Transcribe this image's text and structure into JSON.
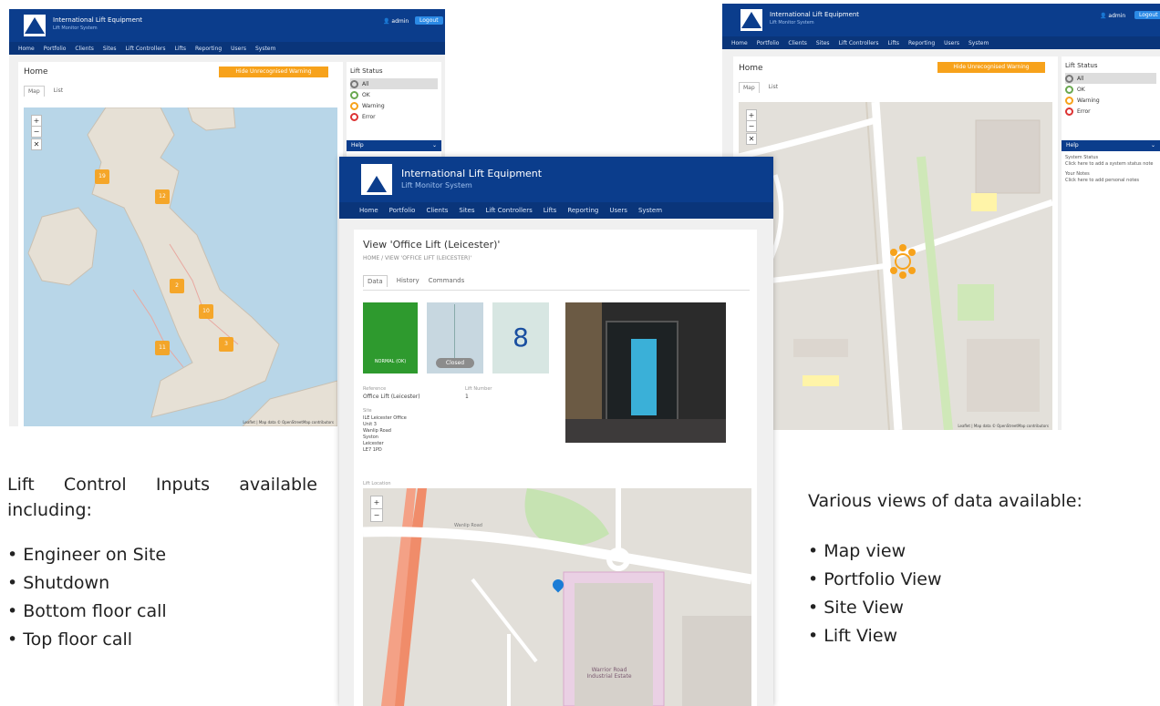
{
  "app": {
    "brand": "International Lift Equipment",
    "subtitle": "Lift Monitor System",
    "user": "admin",
    "logout": "Logout",
    "nav": [
      "Home",
      "Portfolio",
      "Clients",
      "Sites",
      "Lift Controllers",
      "Lifts",
      "Reporting",
      "Users",
      "System"
    ]
  },
  "left_shot": {
    "title": "Home",
    "warning_btn": "Hide Unrecognised Warning",
    "tabs": [
      "Map",
      "List"
    ],
    "zoom_in": "+",
    "zoom_out": "−",
    "reset": "✕",
    "status_title": "Lift Status",
    "status_items": [
      "All",
      "OK",
      "Warning",
      "Error"
    ],
    "help_label": "Help",
    "clusters": [
      "19",
      "12",
      "2",
      "10",
      "11",
      "3"
    ],
    "attribution": "Leaflet | Map data © OpenStreetMap contributors"
  },
  "right_shot": {
    "title": "Home",
    "warning_btn": "Hide Unrecognised Warning",
    "tabs": [
      "Map",
      "List"
    ],
    "zoom_in": "+",
    "zoom_out": "−",
    "reset": "✕",
    "status_title": "Lift Status",
    "status_items": [
      "All",
      "OK",
      "Warning",
      "Error"
    ],
    "help_label": "Help",
    "help_lines": [
      "System Status",
      "Click here to add a system status note",
      "Your Notes",
      "Click here to add personal notes"
    ],
    "attribution": "Leaflet | Map data © OpenStreetMap contributors"
  },
  "center_shot": {
    "view_title": "View 'Office Lift (Leicester)'",
    "breadcrumb": "HOME / VIEW 'OFFICE LIFT (LEICESTER)'",
    "tabs": [
      "Data",
      "History",
      "Commands"
    ],
    "status_tile": "NORMAL (OK)",
    "door_state": "Closed",
    "floor": "8",
    "reference_label": "Reference",
    "reference_value": "Office Lift (Leicester)",
    "lift_number_label": "Lift Number",
    "lift_number_value": "1",
    "site_label": "Site",
    "site_lines": [
      "ILE Leicester Office",
      "Unit 3",
      "Wanlip Road",
      "Syston",
      "Leicester",
      "LE7 1PD"
    ],
    "lift_location_label": "Lift Location",
    "zoom_in": "+",
    "zoom_out": "−",
    "map_labels": [
      "Wanlip Road",
      "Warrior Road Industrial Estate"
    ]
  },
  "captions": {
    "left_heading": "Lift Control Inputs available including:",
    "left_items": [
      "Engineer on Site",
      "Shutdown",
      "Bottom floor call",
      "Top floor call"
    ],
    "right_heading": "Various views of data available:",
    "right_items": [
      "Map view",
      "Portfolio View",
      "Site View",
      "Lift View"
    ]
  },
  "colors": {
    "brand_blue": "#0b3d8c",
    "accent_orange": "#f7a21b",
    "ok_green": "#2e9a2e",
    "map_land": "#e6e0d5"
  }
}
